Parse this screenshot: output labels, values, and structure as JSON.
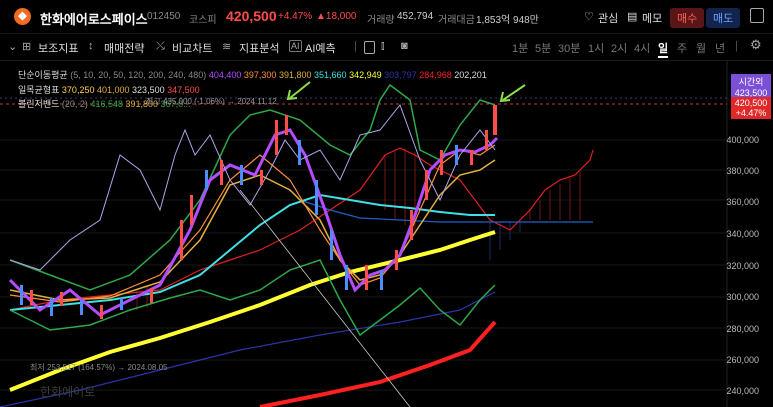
{
  "header": {
    "stock_name": "한화에어로스페이스",
    "code": "012450",
    "market": "코스피",
    "price": "420,500",
    "change_pct": "+4.47%",
    "change_abs": "▲18,000",
    "volume_label": "거래량",
    "volume_value": "452,794",
    "amount_label": "거래대금",
    "amount_value": "1,853억 948만",
    "watch_label": "관심",
    "memo_label": "메모",
    "buy_label": "매수",
    "sell_label": "매도"
  },
  "toolbar": {
    "items": [
      "보조지표",
      "매매전략",
      "비교차트",
      "지표분석",
      "AI예측"
    ],
    "timeframes": [
      "1분",
      "5분",
      "30분",
      "1시",
      "2시",
      "4시",
      "일",
      "주",
      "월",
      "년"
    ],
    "active_timeframe": "일"
  },
  "indicators": {
    "sma_label": "단순이동평균",
    "sma_params": "(5, 10, 20, 50, 120, 200, 240, 480)",
    "sma_values": [
      "404,400",
      "397,300",
      "391,800",
      "351,660",
      "342,949",
      "303,797",
      "284,968",
      "202,201"
    ],
    "ichimoku_label": "일목균형표",
    "ichimoku_values": [
      "370,250",
      "401,000",
      "323,500",
      "347,500"
    ],
    "bollinger_label": "볼린저밴드",
    "bollinger_params": "(20, 2)",
    "bollinger_values": [
      "416,548",
      "391,800",
      "367,0..."
    ]
  },
  "annotations": {
    "high_marker": "최고 435,000 (-1.06%) → 2024.11.12",
    "low_marker": "최저 253,517 (164.57%) → 2024.08.05",
    "bottom_faded": "한화에어로"
  },
  "price_label": {
    "time_title": "시간외",
    "time_price": "423,500",
    "current_price": "420,500",
    "current_change": "+4.47%"
  },
  "y_axis": [
    "400,000",
    "380,000",
    "360,000",
    "340,000",
    "320,000",
    "300,000",
    "280,000",
    "260,000",
    "240,000"
  ],
  "colors": {
    "up": "#ff4d4d",
    "down": "#4d8dff",
    "sma5": "#b44cff",
    "sma10": "#ff8f3a",
    "sma20": "#e0b040",
    "sma50": "#3fe0e6",
    "sma120": "#ffff33",
    "sma200": "#2a36a8",
    "sma240": "#ff2020",
    "ichimoku_cloud": "#ff3030",
    "bollinger": "#2ea84a",
    "arrow": "#8de04a"
  }
}
